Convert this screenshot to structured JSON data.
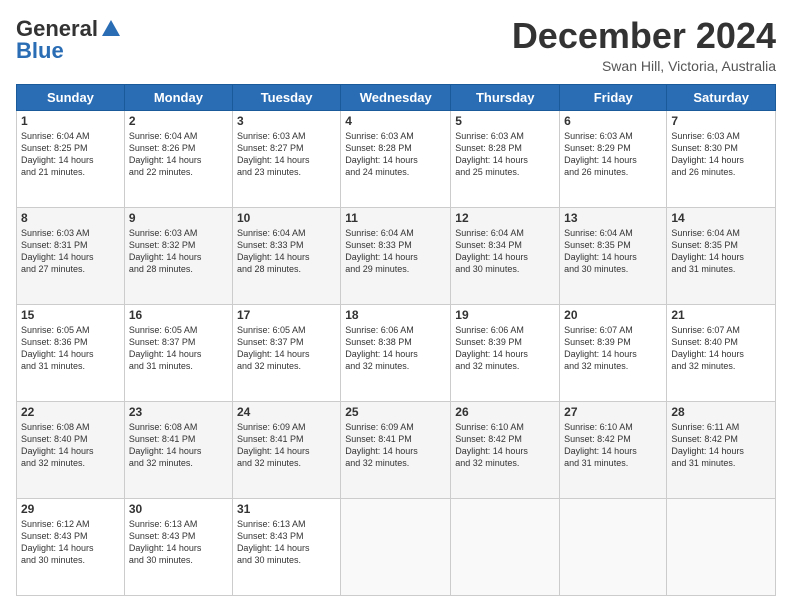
{
  "header": {
    "logo_general": "General",
    "logo_blue": "Blue",
    "month_title": "December 2024",
    "subtitle": "Swan Hill, Victoria, Australia"
  },
  "days_of_week": [
    "Sunday",
    "Monday",
    "Tuesday",
    "Wednesday",
    "Thursday",
    "Friday",
    "Saturday"
  ],
  "weeks": [
    [
      {
        "day": "1",
        "sunrise": "Sunrise: 6:04 AM",
        "sunset": "Sunset: 8:25 PM",
        "daylight": "Daylight: 14 hours and 21 minutes."
      },
      {
        "day": "2",
        "sunrise": "Sunrise: 6:04 AM",
        "sunset": "Sunset: 8:26 PM",
        "daylight": "Daylight: 14 hours and 22 minutes."
      },
      {
        "day": "3",
        "sunrise": "Sunrise: 6:03 AM",
        "sunset": "Sunset: 8:27 PM",
        "daylight": "Daylight: 14 hours and 23 minutes."
      },
      {
        "day": "4",
        "sunrise": "Sunrise: 6:03 AM",
        "sunset": "Sunset: 8:28 PM",
        "daylight": "Daylight: 14 hours and 24 minutes."
      },
      {
        "day": "5",
        "sunrise": "Sunrise: 6:03 AM",
        "sunset": "Sunset: 8:28 PM",
        "daylight": "Daylight: 14 hours and 25 minutes."
      },
      {
        "day": "6",
        "sunrise": "Sunrise: 6:03 AM",
        "sunset": "Sunset: 8:29 PM",
        "daylight": "Daylight: 14 hours and 26 minutes."
      },
      {
        "day": "7",
        "sunrise": "Sunrise: 6:03 AM",
        "sunset": "Sunset: 8:30 PM",
        "daylight": "Daylight: 14 hours and 26 minutes."
      }
    ],
    [
      {
        "day": "8",
        "sunrise": "Sunrise: 6:03 AM",
        "sunset": "Sunset: 8:31 PM",
        "daylight": "Daylight: 14 hours and 27 minutes."
      },
      {
        "day": "9",
        "sunrise": "Sunrise: 6:03 AM",
        "sunset": "Sunset: 8:32 PM",
        "daylight": "Daylight: 14 hours and 28 minutes."
      },
      {
        "day": "10",
        "sunrise": "Sunrise: 6:04 AM",
        "sunset": "Sunset: 8:33 PM",
        "daylight": "Daylight: 14 hours and 28 minutes."
      },
      {
        "day": "11",
        "sunrise": "Sunrise: 6:04 AM",
        "sunset": "Sunset: 8:33 PM",
        "daylight": "Daylight: 14 hours and 29 minutes."
      },
      {
        "day": "12",
        "sunrise": "Sunrise: 6:04 AM",
        "sunset": "Sunset: 8:34 PM",
        "daylight": "Daylight: 14 hours and 30 minutes."
      },
      {
        "day": "13",
        "sunrise": "Sunrise: 6:04 AM",
        "sunset": "Sunset: 8:35 PM",
        "daylight": "Daylight: 14 hours and 30 minutes."
      },
      {
        "day": "14",
        "sunrise": "Sunrise: 6:04 AM",
        "sunset": "Sunset: 8:35 PM",
        "daylight": "Daylight: 14 hours and 31 minutes."
      }
    ],
    [
      {
        "day": "15",
        "sunrise": "Sunrise: 6:05 AM",
        "sunset": "Sunset: 8:36 PM",
        "daylight": "Daylight: 14 hours and 31 minutes."
      },
      {
        "day": "16",
        "sunrise": "Sunrise: 6:05 AM",
        "sunset": "Sunset: 8:37 PM",
        "daylight": "Daylight: 14 hours and 31 minutes."
      },
      {
        "day": "17",
        "sunrise": "Sunrise: 6:05 AM",
        "sunset": "Sunset: 8:37 PM",
        "daylight": "Daylight: 14 hours and 32 minutes."
      },
      {
        "day": "18",
        "sunrise": "Sunrise: 6:06 AM",
        "sunset": "Sunset: 8:38 PM",
        "daylight": "Daylight: 14 hours and 32 minutes."
      },
      {
        "day": "19",
        "sunrise": "Sunrise: 6:06 AM",
        "sunset": "Sunset: 8:39 PM",
        "daylight": "Daylight: 14 hours and 32 minutes."
      },
      {
        "day": "20",
        "sunrise": "Sunrise: 6:07 AM",
        "sunset": "Sunset: 8:39 PM",
        "daylight": "Daylight: 14 hours and 32 minutes."
      },
      {
        "day": "21",
        "sunrise": "Sunrise: 6:07 AM",
        "sunset": "Sunset: 8:40 PM",
        "daylight": "Daylight: 14 hours and 32 minutes."
      }
    ],
    [
      {
        "day": "22",
        "sunrise": "Sunrise: 6:08 AM",
        "sunset": "Sunset: 8:40 PM",
        "daylight": "Daylight: 14 hours and 32 minutes."
      },
      {
        "day": "23",
        "sunrise": "Sunrise: 6:08 AM",
        "sunset": "Sunset: 8:41 PM",
        "daylight": "Daylight: 14 hours and 32 minutes."
      },
      {
        "day": "24",
        "sunrise": "Sunrise: 6:09 AM",
        "sunset": "Sunset: 8:41 PM",
        "daylight": "Daylight: 14 hours and 32 minutes."
      },
      {
        "day": "25",
        "sunrise": "Sunrise: 6:09 AM",
        "sunset": "Sunset: 8:41 PM",
        "daylight": "Daylight: 14 hours and 32 minutes."
      },
      {
        "day": "26",
        "sunrise": "Sunrise: 6:10 AM",
        "sunset": "Sunset: 8:42 PM",
        "daylight": "Daylight: 14 hours and 32 minutes."
      },
      {
        "day": "27",
        "sunrise": "Sunrise: 6:10 AM",
        "sunset": "Sunset: 8:42 PM",
        "daylight": "Daylight: 14 hours and 31 minutes."
      },
      {
        "day": "28",
        "sunrise": "Sunrise: 6:11 AM",
        "sunset": "Sunset: 8:42 PM",
        "daylight": "Daylight: 14 hours and 31 minutes."
      }
    ],
    [
      {
        "day": "29",
        "sunrise": "Sunrise: 6:12 AM",
        "sunset": "Sunset: 8:43 PM",
        "daylight": "Daylight: 14 hours and 30 minutes."
      },
      {
        "day": "30",
        "sunrise": "Sunrise: 6:13 AM",
        "sunset": "Sunset: 8:43 PM",
        "daylight": "Daylight: 14 hours and 30 minutes."
      },
      {
        "day": "31",
        "sunrise": "Sunrise: 6:13 AM",
        "sunset": "Sunset: 8:43 PM",
        "daylight": "Daylight: 14 hours and 30 minutes."
      },
      null,
      null,
      null,
      null
    ]
  ]
}
